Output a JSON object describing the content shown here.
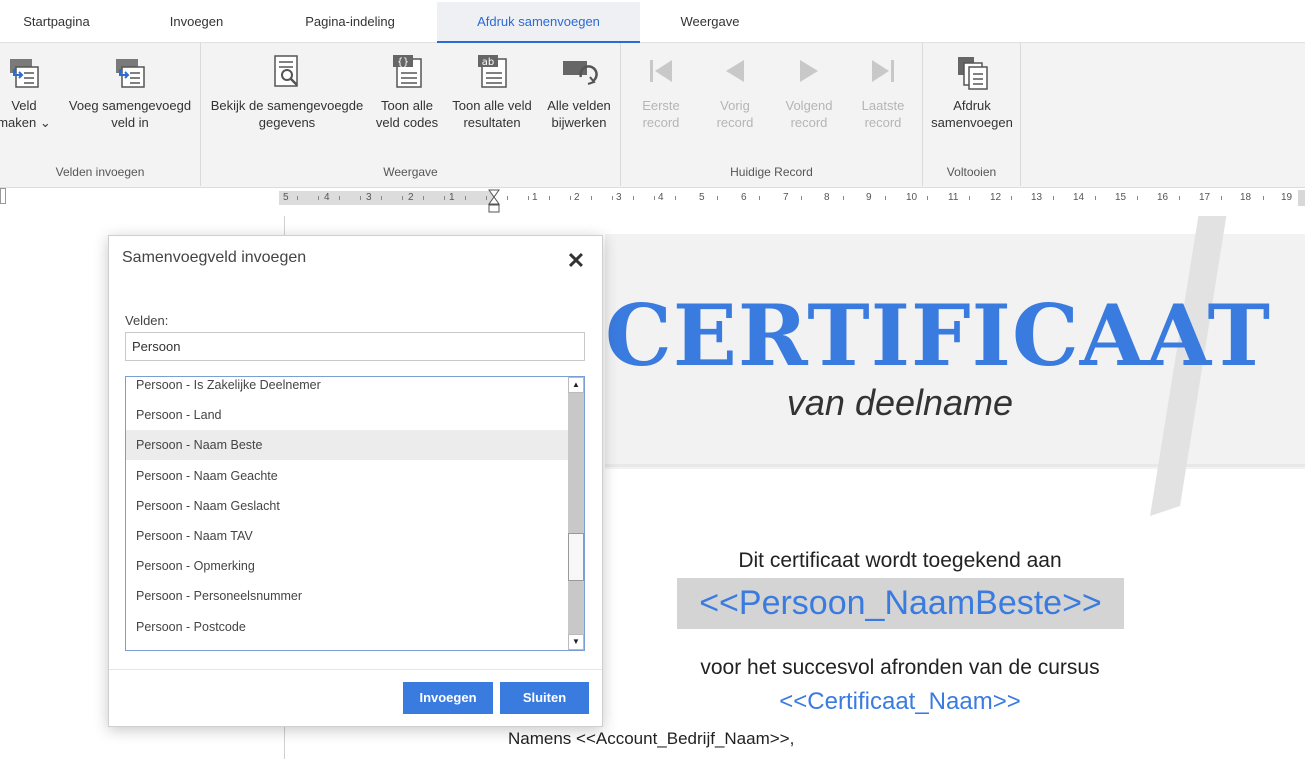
{
  "tabs": [
    {
      "label": "Startpagina",
      "active": false
    },
    {
      "label": "Invoegen",
      "active": false
    },
    {
      "label": "Pagina-indeling",
      "active": false
    },
    {
      "label": "Afdruk samenvoegen",
      "active": true
    },
    {
      "label": "Weergave",
      "active": false
    }
  ],
  "ribbon": {
    "groups": {
      "velden": "Velden invoegen",
      "weergave": "Weergave",
      "record": "Huidige Record",
      "voltooien": "Voltooien"
    },
    "buttons": {
      "veld_maken": {
        "line1": "Veld",
        "line2": "maken",
        "arrow": "⌄"
      },
      "voeg_samengevoegd": {
        "line1": "Voeg samengevoegd",
        "line2": "veld in"
      },
      "bekijk": {
        "line1": "Bekijk de samengevoegde",
        "line2": "gegevens"
      },
      "toon_codes": {
        "line1": "Toon alle",
        "line2": "veld codes"
      },
      "toon_resultaten": {
        "line1": "Toon alle veld",
        "line2": "resultaten"
      },
      "bijwerken": {
        "line1": "Alle velden",
        "line2": "bijwerken"
      },
      "eerste": {
        "line1": "Eerste",
        "line2": "record"
      },
      "vorig": {
        "line1": "Vorig",
        "line2": "record"
      },
      "volgend": {
        "line1": "Volgend",
        "line2": "record"
      },
      "laatste": {
        "line1": "Laatste",
        "line2": "record"
      },
      "afdruk": {
        "line1": "Afdruk",
        "line2": "samenvoegen"
      }
    }
  },
  "ruler": {
    "labels": [
      "5",
      "4",
      "3",
      "2",
      "1",
      "1",
      "2",
      "3",
      "4",
      "5",
      "6",
      "7",
      "8",
      "9",
      "10",
      "11",
      "12",
      "13",
      "14",
      "15",
      "16",
      "17",
      "18",
      "19"
    ]
  },
  "document": {
    "title": "CERTIFICAAT",
    "subtitle": "van deelname",
    "awarded_text": "Dit certificaat wordt toegekend aan",
    "person_field": "<<Persoon_NaamBeste>>",
    "success_text": "voor het succesvol afronden van de cursus",
    "course_field": "<<Certificaat_Naam>>",
    "namens_text": "Namens <<Account_Bedrijf_Naam>>,"
  },
  "dialog": {
    "title": "Samenvoegveld invoegen",
    "close_glyph": "✕",
    "fields_label": "Velden:",
    "search_value": "Persoon",
    "items": [
      "Persoon - Is Zakelijke Deelnemer",
      "Persoon - Land",
      "Persoon - Naam Beste",
      "Persoon - Naam Geachte",
      "Persoon - Naam Geslacht",
      "Persoon - Naam TAV",
      "Persoon - Opmerking",
      "Persoon - Personeelsnummer",
      "Persoon - Postcode"
    ],
    "selected_index": 2,
    "scroll_up": "▲",
    "scroll_down": "▼",
    "insert_label": "Invoegen",
    "close_label": "Sluiten"
  },
  "colors": {
    "accent": "#3a7be0",
    "tab_active": "#2b6bd6",
    "ribbon_bg": "#f3f3f3",
    "disabled": "#b5b5b5"
  }
}
